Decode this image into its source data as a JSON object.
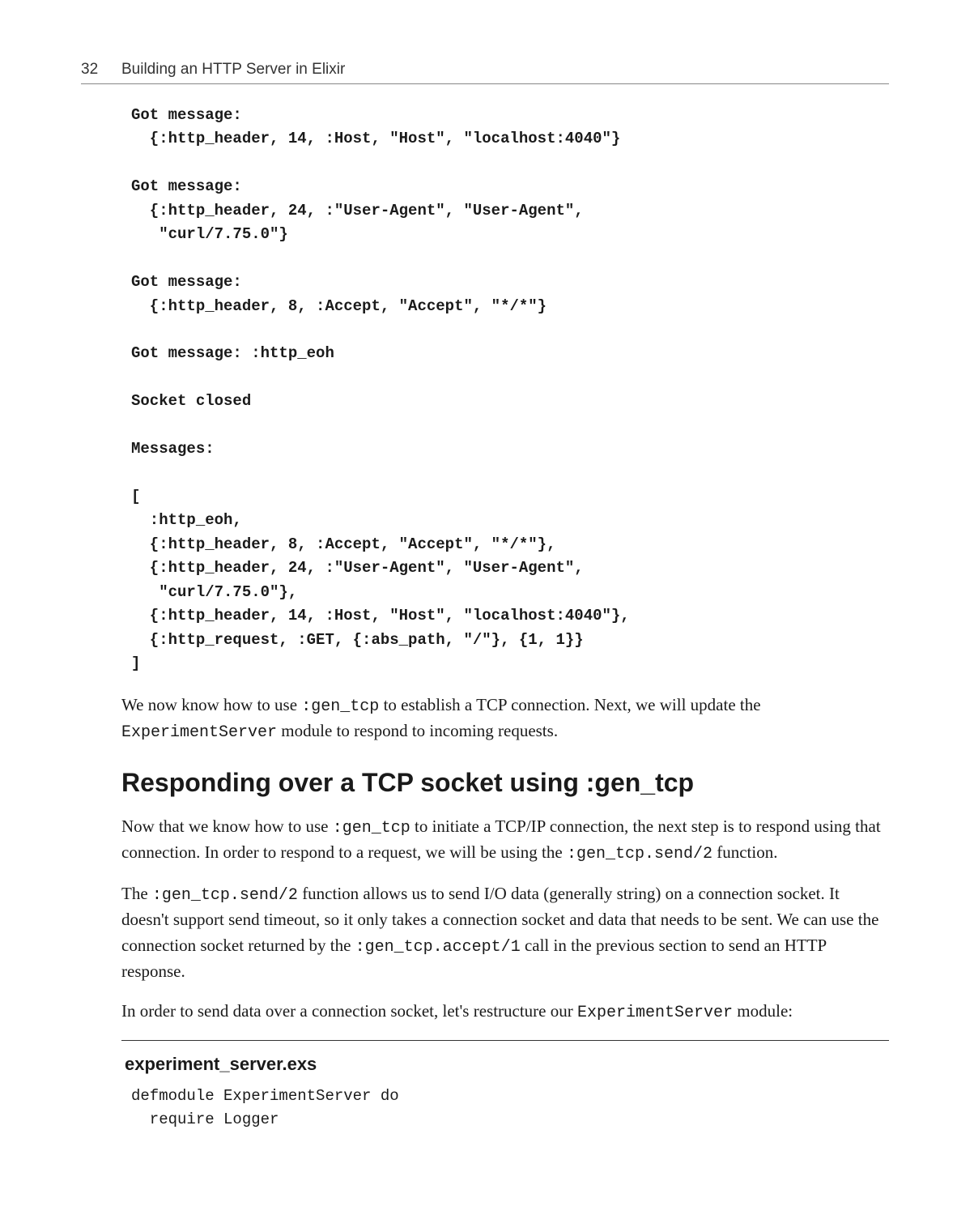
{
  "header": {
    "page_number": "32",
    "title": "Building an HTTP Server in Elixir"
  },
  "code1": "Got message:\n  {:http_header, 14, :Host, \"Host\", \"localhost:4040\"}\n\nGot message:\n  {:http_header, 24, :\"User-Agent\", \"User-Agent\",\n   \"curl/7.75.0\"}\n\nGot message:\n  {:http_header, 8, :Accept, \"Accept\", \"*/*\"}\n\nGot message: :http_eoh\n\nSocket closed\n\nMessages:\n\n[\n  :http_eoh,\n  {:http_header, 8, :Accept, \"Accept\", \"*/*\"},\n  {:http_header, 24, :\"User-Agent\", \"User-Agent\",\n   \"curl/7.75.0\"},\n  {:http_header, 14, :Host, \"Host\", \"localhost:4040\"},\n  {:http_request, :GET, {:abs_path, \"/\"}, {1, 1}}\n]",
  "para1": {
    "t1": "We now know how to use ",
    "c1": ":gen_tcp",
    "t2": " to establish a TCP connection. Next, we will update the ",
    "c2": "ExperimentServer",
    "t3": " module to respond to incoming requests."
  },
  "heading": "Responding over a TCP socket using :gen_tcp",
  "para2": {
    "t1": "Now that we know how to use ",
    "c1": ":gen_tcp",
    "t2": " to initiate a TCP/IP connection, the next step is to respond using that connection. In order to respond to a request, we will be using the ",
    "c2": ":gen_tcp.send/2",
    "t3": " function."
  },
  "para3": {
    "t1": "The ",
    "c1": ":gen_tcp.send/2",
    "t2": " function allows us to send I/O data (generally string) on a connection socket. It doesn't support send timeout, so it only takes a connection socket and data that needs to be sent. We can use the connection socket returned by the ",
    "c2": ":gen_tcp.accept/1",
    "t3": " call in the previous section to send an HTTP response."
  },
  "para4": {
    "t1": "In order to send data over a connection socket, let's restructure our ",
    "c1": "ExperimentServer",
    "t2": " module:"
  },
  "file_tag": "experiment_server.exs",
  "code2": "defmodule ExperimentServer do\n  require Logger"
}
